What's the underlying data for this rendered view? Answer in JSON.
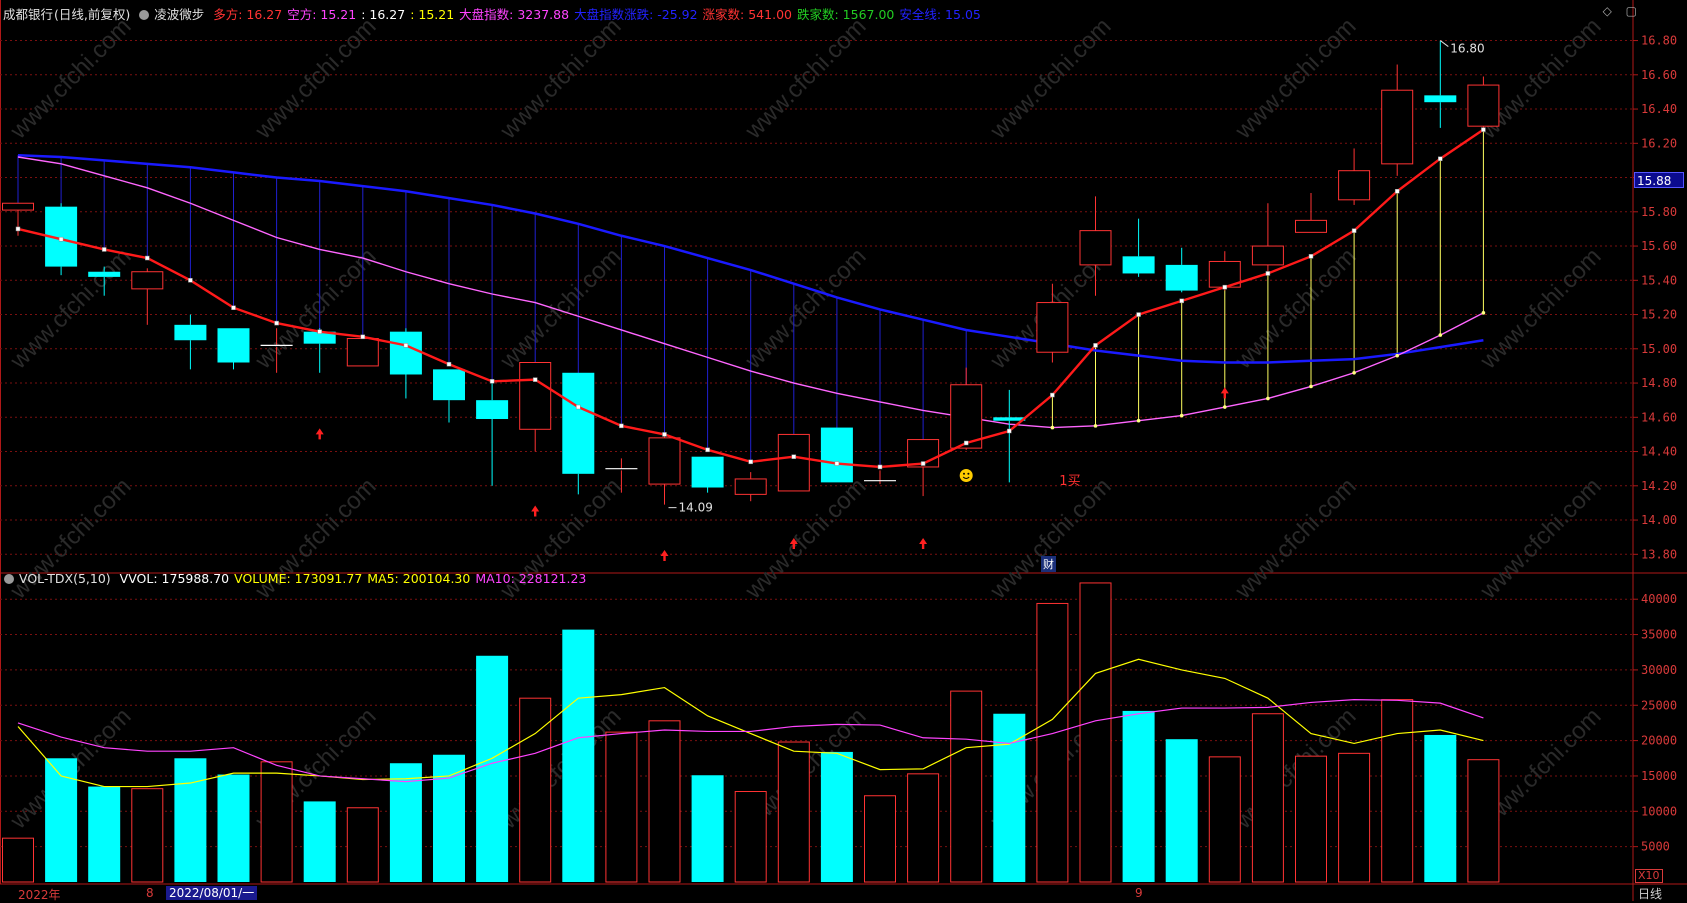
{
  "header": {
    "stock_name": "成都银行",
    "period": "(日线,前复权)",
    "indicator_name": "凌波微步",
    "items": [
      {
        "label": "多方:",
        "value": "16.27",
        "color": "#ff3333"
      },
      {
        "label": "空方:",
        "value": "15.21",
        "color": "#ff44ff"
      },
      {
        "label": "",
        "value": ": 16.27",
        "color": "#ffffff"
      },
      {
        "label": "",
        "value": ": 15.21",
        "color": "#ffff00"
      },
      {
        "label": "大盘指数:",
        "value": "3237.88",
        "color": "#ff44ff"
      },
      {
        "label": "大盘指数涨跌:",
        "value": "-25.92",
        "color": "#2222ff"
      },
      {
        "label": "涨家数:",
        "value": "541.00",
        "color": "#ff3333"
      },
      {
        "label": "跌家数:",
        "value": "1567.00",
        "color": "#22cc22"
      },
      {
        "label": "安全线:",
        "value": "15.05",
        "color": "#2222ff"
      }
    ]
  },
  "volume_header": {
    "name": "VOL-TDX(5,10)",
    "items": [
      {
        "label": "VVOL:",
        "value": "175988.70",
        "color": "#ffffff"
      },
      {
        "label": "VOLUME:",
        "value": "173091.77",
        "color": "#ffff00"
      },
      {
        "label": "MA5:",
        "value": "200104.30",
        "color": "#ffff00"
      },
      {
        "label": "MA10:",
        "value": "228121.23",
        "color": "#ff44ff"
      }
    ]
  },
  "price_axis": [
    "16.80",
    "16.60",
    "16.40",
    "16.20",
    "16.00",
    "15.80",
    "15.60",
    "15.40",
    "15.20",
    "15.00",
    "14.80",
    "14.60",
    "14.40",
    "14.20",
    "14.00",
    "13.80"
  ],
  "volume_axis": [
    "40000",
    "35000",
    "30000",
    "25000",
    "20000",
    "15000",
    "10000",
    "5000"
  ],
  "current_price_tag": "15.88",
  "annotations": {
    "high_label": "16.80",
    "low_label": "14.09",
    "buy_signal": "1买",
    "finance_marker": "财"
  },
  "bottom": {
    "year_label": "2022年",
    "month_8": "8",
    "date_box": "2022/08/01/一",
    "month_9": "9",
    "period_label": "日线",
    "zoom_label": "X10"
  },
  "watermark": "www.cfchi.com",
  "colors": {
    "up": "#ff3333",
    "down": "#00ffff",
    "ma_red": "#ff1a1a",
    "ma_blue": "#1a1aff",
    "ma_violet": "#ff66ff",
    "vol_ma5": "#ffff00",
    "vol_ma10": "#ff44ff",
    "grid": "#7a1010"
  },
  "chart_data": {
    "type": "candlestick",
    "price_range": [
      13.72,
      16.92
    ],
    "volume_range": [
      0,
      43000
    ],
    "candles": [
      {
        "o": 15.81,
        "h": 15.84,
        "l": 15.66,
        "c": 15.85
      },
      {
        "o": 15.83,
        "h": 15.85,
        "l": 15.43,
        "c": 15.48
      },
      {
        "o": 15.45,
        "h": 15.48,
        "l": 15.31,
        "c": 15.42
      },
      {
        "o": 15.35,
        "h": 15.47,
        "l": 15.14,
        "c": 15.45
      },
      {
        "o": 15.14,
        "h": 15.2,
        "l": 14.88,
        "c": 15.05
      },
      {
        "o": 15.12,
        "h": 15.12,
        "l": 14.88,
        "c": 14.92
      },
      {
        "o": 15.01,
        "h": 15.12,
        "l": 14.86,
        "c": 15.02
      },
      {
        "o": 15.1,
        "h": 15.12,
        "l": 14.86,
        "c": 15.03
      },
      {
        "o": 14.9,
        "h": 15.07,
        "l": 14.9,
        "c": 15.06
      },
      {
        "o": 15.1,
        "h": 15.12,
        "l": 14.71,
        "c": 14.85
      },
      {
        "o": 14.88,
        "h": 14.88,
        "l": 14.57,
        "c": 14.7
      },
      {
        "o": 14.7,
        "h": 14.82,
        "l": 14.2,
        "c": 14.59
      },
      {
        "o": 14.53,
        "h": 14.92,
        "l": 14.4,
        "c": 14.92
      },
      {
        "o": 14.86,
        "h": 14.86,
        "l": 14.15,
        "c": 14.27
      },
      {
        "o": 14.29,
        "h": 14.36,
        "l": 14.16,
        "c": 14.3
      },
      {
        "o": 14.21,
        "h": 14.49,
        "l": 14.09,
        "c": 14.48
      },
      {
        "o": 14.37,
        "h": 14.37,
        "l": 14.16,
        "c": 14.19
      },
      {
        "o": 14.15,
        "h": 14.28,
        "l": 14.11,
        "c": 14.24
      },
      {
        "o": 14.17,
        "h": 14.5,
        "l": 14.17,
        "c": 14.5
      },
      {
        "o": 14.54,
        "h": 14.54,
        "l": 14.22,
        "c": 14.22
      },
      {
        "o": 14.23,
        "h": 14.29,
        "l": 14.21,
        "c": 14.23
      },
      {
        "o": 14.31,
        "h": 14.46,
        "l": 14.14,
        "c": 14.47
      },
      {
        "o": 14.42,
        "h": 14.89,
        "l": 14.41,
        "c": 14.79
      },
      {
        "o": 14.6,
        "h": 14.76,
        "l": 14.22,
        "c": 14.58
      },
      {
        "o": 14.98,
        "h": 15.38,
        "l": 14.92,
        "c": 15.27
      },
      {
        "o": 15.49,
        "h": 15.89,
        "l": 15.31,
        "c": 15.69
      },
      {
        "o": 15.54,
        "h": 15.76,
        "l": 15.42,
        "c": 15.44
      },
      {
        "o": 15.49,
        "h": 15.59,
        "l": 15.33,
        "c": 15.34
      },
      {
        "o": 15.36,
        "h": 15.57,
        "l": 15.34,
        "c": 15.51
      },
      {
        "o": 15.49,
        "h": 15.85,
        "l": 15.45,
        "c": 15.6
      },
      {
        "o": 15.68,
        "h": 15.91,
        "l": 15.68,
        "c": 15.75
      },
      {
        "o": 15.87,
        "h": 16.17,
        "l": 15.84,
        "c": 16.04
      },
      {
        "o": 16.08,
        "h": 16.66,
        "l": 16.01,
        "c": 16.51
      },
      {
        "o": 16.48,
        "h": 16.8,
        "l": 16.29,
        "c": 16.44
      },
      {
        "o": 16.3,
        "h": 16.59,
        "l": 16.27,
        "c": 16.54
      }
    ],
    "volumes": [
      6200,
      17500,
      13500,
      13200,
      17500,
      15200,
      17000,
      11400,
      10500,
      16800,
      18000,
      32000,
      26000,
      35700,
      21200,
      22800,
      15100,
      12800,
      19800,
      18400,
      12200,
      15300,
      27000,
      23800,
      39400,
      42300,
      24200,
      20200,
      17700,
      23800,
      17800,
      18200,
      25800,
      20800,
      17300
    ],
    "ma_red": [
      15.7,
      15.64,
      15.58,
      15.53,
      15.4,
      15.24,
      15.15,
      15.1,
      15.07,
      15.02,
      14.91,
      14.81,
      14.82,
      14.66,
      14.55,
      14.5,
      14.41,
      14.34,
      14.37,
      14.33,
      14.31,
      14.33,
      14.45,
      14.52,
      14.73,
      15.02,
      15.2,
      15.28,
      15.36,
      15.44,
      15.54,
      15.69,
      15.92,
      16.11,
      16.28
    ],
    "ma_violet": [
      16.12,
      16.08,
      16.01,
      15.94,
      15.85,
      15.75,
      15.65,
      15.58,
      15.53,
      15.45,
      15.38,
      15.32,
      15.27,
      15.19,
      15.11,
      15.03,
      14.95,
      14.87,
      14.8,
      14.74,
      14.69,
      14.64,
      14.6,
      14.56,
      14.54,
      14.55,
      14.58,
      14.61,
      14.66,
      14.71,
      14.78,
      14.86,
      14.96,
      15.08,
      15.21
    ],
    "ma_blue": [
      16.13,
      16.12,
      16.1,
      16.08,
      16.06,
      16.03,
      16.0,
      15.98,
      15.95,
      15.92,
      15.88,
      15.84,
      15.79,
      15.73,
      15.66,
      15.6,
      15.53,
      15.46,
      15.38,
      15.3,
      15.23,
      15.17,
      15.11,
      15.07,
      15.03,
      14.99,
      14.96,
      14.93,
      14.92,
      14.92,
      14.93,
      14.94,
      14.97,
      15.01,
      15.05
    ],
    "vol_ma5": [
      22000,
      15000,
      13500,
      13500,
      14000,
      15400,
      15400,
      15000,
      14500,
      14600,
      15000,
      17500,
      21000,
      26000,
      26500,
      27500,
      23500,
      21000,
      18500,
      18200,
      15900,
      16000,
      19000,
      19500,
      23000,
      29500,
      31500,
      30000,
      28800,
      26000,
      21000,
      19600,
      21000,
      21500,
      20000
    ],
    "vol_ma10": [
      22500,
      20500,
      19000,
      18500,
      18500,
      19000,
      16500,
      15000,
      14600,
      14200,
      14700,
      16800,
      18200,
      20400,
      21000,
      21500,
      21300,
      21300,
      22000,
      22300,
      22200,
      20400,
      20200,
      19600,
      21000,
      22800,
      23800,
      24600,
      24600,
      24700,
      25400,
      25800,
      25700,
      25300,
      23200
    ],
    "ma_red_dots_from": 0,
    "yellow_stems": [
      24,
      25,
      26,
      27,
      28,
      29,
      30,
      31,
      32,
      33,
      34
    ],
    "blue_stems": [
      0,
      1,
      2,
      3,
      4,
      5,
      6,
      7,
      8,
      9,
      10,
      11,
      12,
      13,
      14,
      15,
      16,
      17,
      18,
      19,
      20,
      21,
      22
    ],
    "red_arrows": [
      {
        "i": 7,
        "p": 14.5
      },
      {
        "i": 12,
        "p": 14.05
      },
      {
        "i": 15,
        "p": 13.79
      },
      {
        "i": 18,
        "p": 13.86
      },
      {
        "i": 21,
        "p": 13.86
      },
      {
        "i": 28,
        "p": 14.74
      }
    ]
  }
}
